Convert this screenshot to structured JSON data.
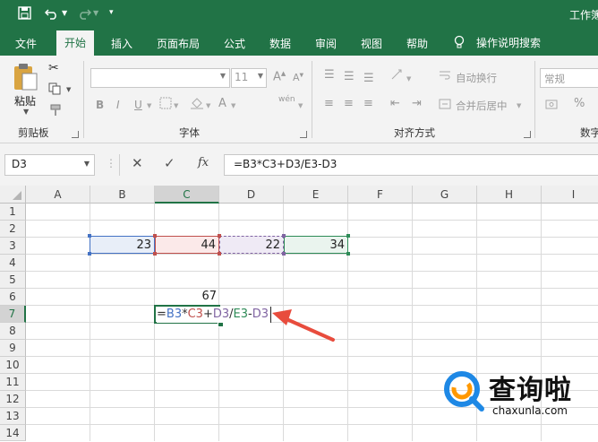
{
  "app": {
    "window_title": "工作簿"
  },
  "quick_access": {
    "save_icon": "save-icon",
    "undo_icon": "undo-icon",
    "redo_icon": "redo-icon",
    "customize_icon": "chevron-down-icon"
  },
  "tabs": [
    {
      "label": "文件"
    },
    {
      "label": "开始"
    },
    {
      "label": "插入"
    },
    {
      "label": "页面布局"
    },
    {
      "label": "公式"
    },
    {
      "label": "数据"
    },
    {
      "label": "审阅"
    },
    {
      "label": "视图"
    },
    {
      "label": "帮助"
    }
  ],
  "tell_me": {
    "label": "操作说明搜索"
  },
  "ribbon": {
    "clipboard": {
      "paste_label": "粘贴",
      "group_label": "剪贴板"
    },
    "font": {
      "font_name": "",
      "font_size": "11",
      "group_label": "字体",
      "bold": "B",
      "italic": "I",
      "underline": "U",
      "font_color_label": "A",
      "phonetic": "wén"
    },
    "alignment": {
      "wrap_text": "自动换行",
      "merge_center": "合并后居中",
      "group_label": "对齐方式"
    },
    "number": {
      "format": "常规",
      "group_label": "数字"
    }
  },
  "formula_bar": {
    "name_box": "D3",
    "fx_label": "fx",
    "formula": "=B3*C3+D3/E3-D3"
  },
  "columns": [
    "A",
    "B",
    "C",
    "D",
    "E",
    "F",
    "G",
    "H",
    "I"
  ],
  "rows": [
    "1",
    "2",
    "3",
    "4",
    "5",
    "6",
    "7",
    "8",
    "9",
    "10",
    "11",
    "12",
    "13",
    "14"
  ],
  "cells": {
    "B3": "23",
    "C3": "44",
    "D3": "22",
    "E3": "34",
    "C6": "67"
  },
  "edit_formula": {
    "parts": [
      {
        "text": "=",
        "color": "#333333"
      },
      {
        "text": "B3",
        "color": "#4472c4"
      },
      {
        "text": "*",
        "color": "#333333"
      },
      {
        "text": "C3",
        "color": "#c0504d"
      },
      {
        "text": "+",
        "color": "#333333"
      },
      {
        "text": "D3",
        "color": "#8064a2"
      },
      {
        "text": "/",
        "color": "#333333"
      },
      {
        "text": "E3",
        "color": "#2e8b57"
      },
      {
        "text": "-",
        "color": "#333333"
      },
      {
        "text": "D3",
        "color": "#8064a2"
      }
    ]
  },
  "ref_colors": {
    "B3": "#4472c4",
    "C3": "#c0504d",
    "D3": "#8064a2",
    "E3": "#2e8b57"
  },
  "watermark": {
    "brand": "查询啦",
    "url": "chaxunla.com"
  }
}
